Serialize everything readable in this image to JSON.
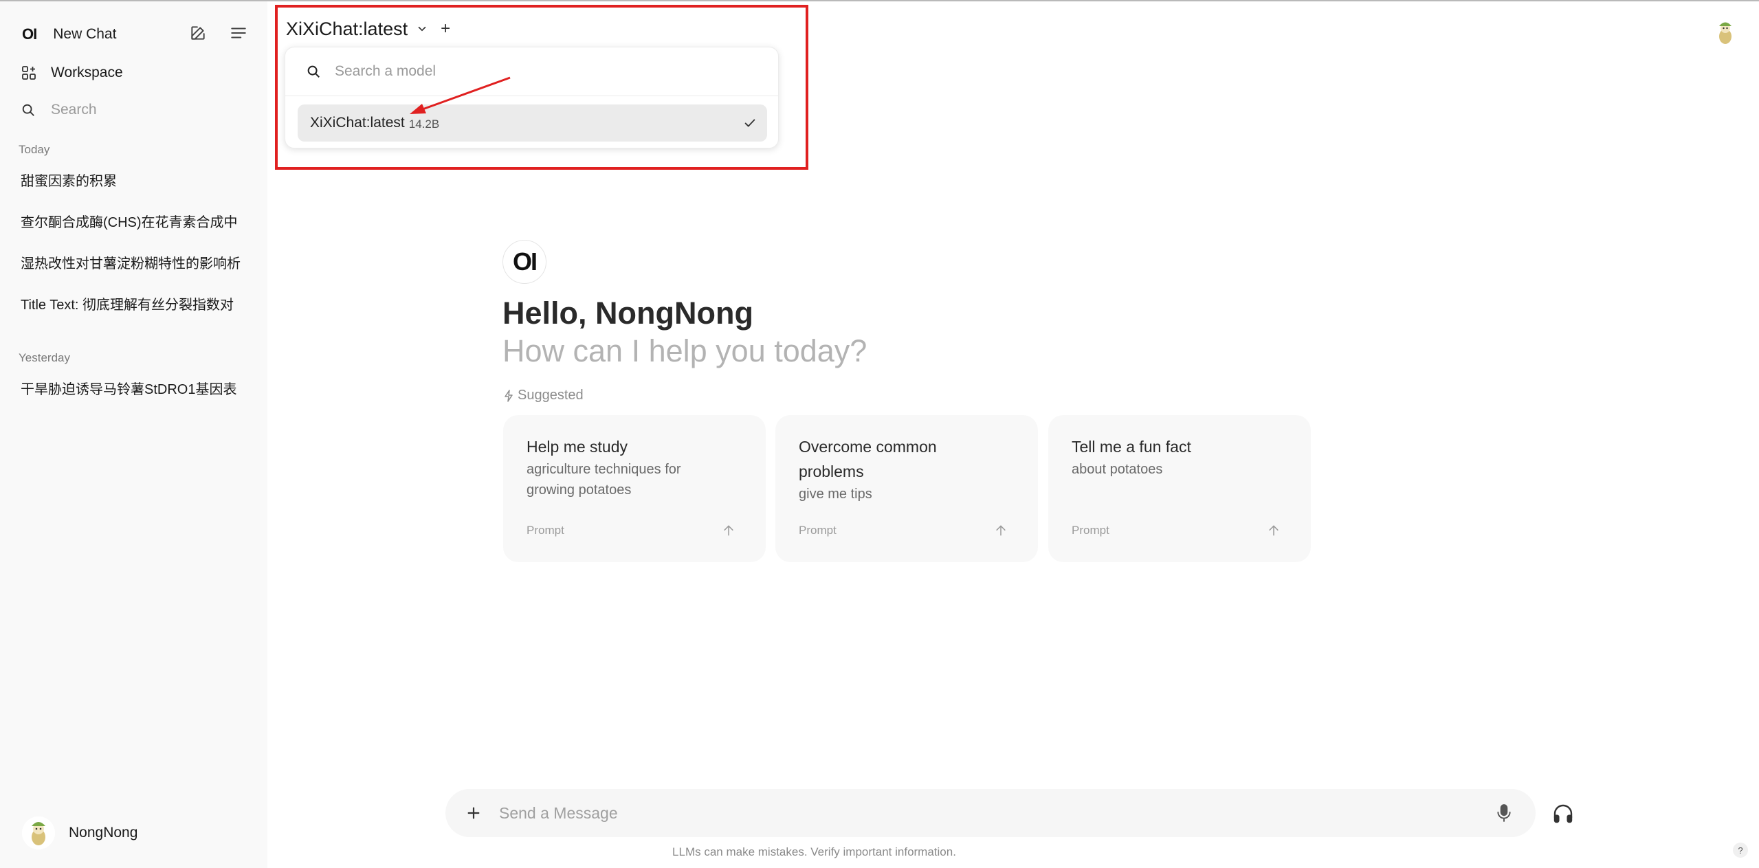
{
  "sidebar": {
    "logo": "OI",
    "new_chat": "New Chat",
    "workspace": "Workspace",
    "search": "Search",
    "sections": [
      {
        "label": "Today",
        "items": [
          "甜蜜因素的积累",
          "查尔酮合成酶(CHS)在花青素合成中",
          "湿热改性对甘薯淀粉糊特性的影响析",
          "Title Text: 彻底理解有丝分裂指数对"
        ]
      },
      {
        "label": "Yesterday",
        "items": [
          "干旱胁迫诱导马铃薯StDRO1基因表"
        ]
      }
    ],
    "user_name": "NongNong"
  },
  "model_selector": {
    "current": "XiXiChat:latest",
    "add": "+",
    "search_placeholder": "Search a model",
    "options": [
      {
        "name": "XiXiChat:latest",
        "size": "14.2B",
        "selected": true
      }
    ]
  },
  "welcome": {
    "logo": "OI",
    "greeting": "Hello, NongNong",
    "subtitle": "How can I help you today?",
    "suggested_label": "Suggested",
    "cards": [
      {
        "title": "Help me study",
        "subtitle": "agriculture techniques for growing potatoes",
        "tag": "Prompt"
      },
      {
        "title": "Overcome common problems",
        "subtitle": "give me tips",
        "tag": "Prompt"
      },
      {
        "title": "Tell me a fun fact",
        "subtitle": "about potatoes",
        "tag": "Prompt"
      }
    ]
  },
  "composer": {
    "placeholder": "Send a Message",
    "disclaimer": "LLMs can make mistakes. Verify important information.",
    "help": "?"
  },
  "colors": {
    "highlight": "#e02020",
    "sidebar_bg": "#f9f9f9",
    "card_bg": "#f8f8f8"
  }
}
